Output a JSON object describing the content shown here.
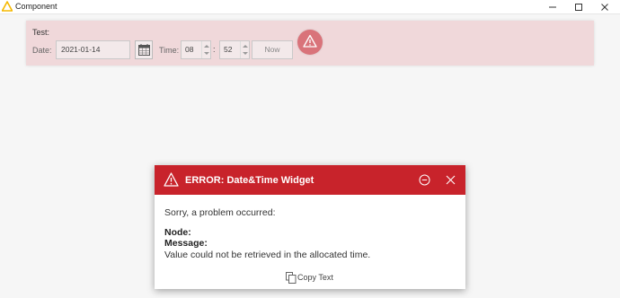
{
  "window": {
    "title": "Component",
    "app_icon": "warning-triangle-icon"
  },
  "widget": {
    "section_label": "Test:",
    "date_label": "Date:",
    "date_value": "2021-01-14",
    "time_label": "Time:",
    "hour_value": "08",
    "colon": ":",
    "minute_value": "52",
    "now_label": "Now",
    "warning_icon": "warning-icon"
  },
  "dialog": {
    "title": "ERROR: Date&Time Widget",
    "sorry": "Sorry, a problem occurred:",
    "node_label": "Node:",
    "message_label": "Message:",
    "message_text": "Value could not be retrieved in the allocated time.",
    "copy_label": "Copy Text"
  },
  "colors": {
    "panel_bg": "#f0d8da",
    "error_red": "#c8232b",
    "warn_circle": "#d9737a",
    "app_icon_yellow": "#f5b800"
  }
}
